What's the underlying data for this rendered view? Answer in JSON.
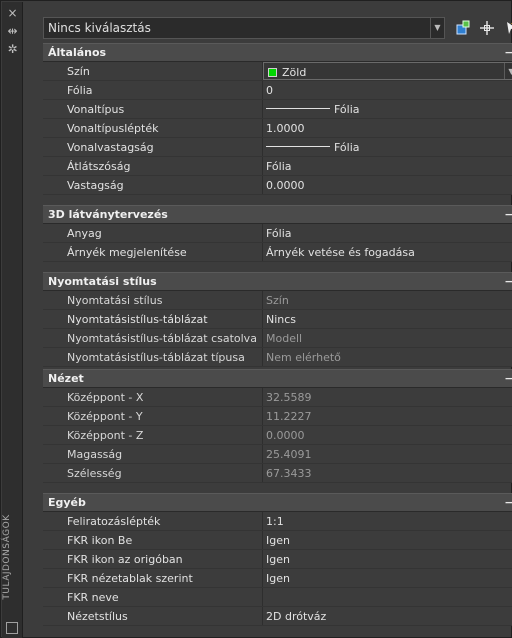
{
  "sidebar": {
    "close_icon": "×",
    "autohide_icon": "⇹",
    "settings_icon": "✲",
    "vertical_title": "TULAJDONSÁGOK"
  },
  "top": {
    "combo_value": "Nincs kiválasztás"
  },
  "sections": {
    "altalanos": {
      "title": "Általános",
      "rows": [
        {
          "label": "Szín",
          "value": "Zöld"
        },
        {
          "label": "Fólia",
          "value": "0"
        },
        {
          "label": "Vonaltípus",
          "value": "Fólia"
        },
        {
          "label": "Vonaltípuslépték",
          "value": "1.0000"
        },
        {
          "label": "Vonalvastagság",
          "value": "Fólia"
        },
        {
          "label": "Átlátszóság",
          "value": "Fólia"
        },
        {
          "label": "Vastagság",
          "value": "0.0000"
        }
      ]
    },
    "latvany": {
      "title": "3D látványtervezés",
      "rows": [
        {
          "label": "Anyag",
          "value": "Fólia"
        },
        {
          "label": "Árnyék megjelenítése",
          "value": "Árnyék vetése és fogadása"
        }
      ]
    },
    "nyomtatas": {
      "title": "Nyomtatási stílus",
      "rows": [
        {
          "label": "Nyomtatási stílus",
          "value": "Szín"
        },
        {
          "label": "Nyomtatásistílus-táblázat",
          "value": "Nincs"
        },
        {
          "label": "Nyomtatásistílus-táblázat csatolva",
          "value": "Modell"
        },
        {
          "label": "Nyomtatásistílus-táblázat típusa",
          "value": "Nem elérhető"
        }
      ]
    },
    "nezet": {
      "title": "Nézet",
      "rows": [
        {
          "label": "Középpont - X",
          "value": "32.5589"
        },
        {
          "label": "Középpont - Y",
          "value": "11.2227"
        },
        {
          "label": "Középpont - Z",
          "value": "0.0000"
        },
        {
          "label": "Magasság",
          "value": "25.4091"
        },
        {
          "label": "Szélesség",
          "value": "67.3433"
        }
      ]
    },
    "egyeb": {
      "title": "Egyéb",
      "rows": [
        {
          "label": "Feliratozáslépték",
          "value": "1:1"
        },
        {
          "label": "FKR ikon Be",
          "value": "Igen"
        },
        {
          "label": "FKR ikon az origóban",
          "value": "Igen"
        },
        {
          "label": "FKR nézetablak szerint",
          "value": "Igen"
        },
        {
          "label": "FKR neve",
          "value": ""
        },
        {
          "label": "Nézetstílus",
          "value": "2D drótváz"
        }
      ]
    }
  },
  "colors": {
    "swatch_green": "#00d600",
    "panel_bg": "#3c3c3c",
    "section_bg": "#4b4b4b"
  },
  "collapse_glyph": "−"
}
